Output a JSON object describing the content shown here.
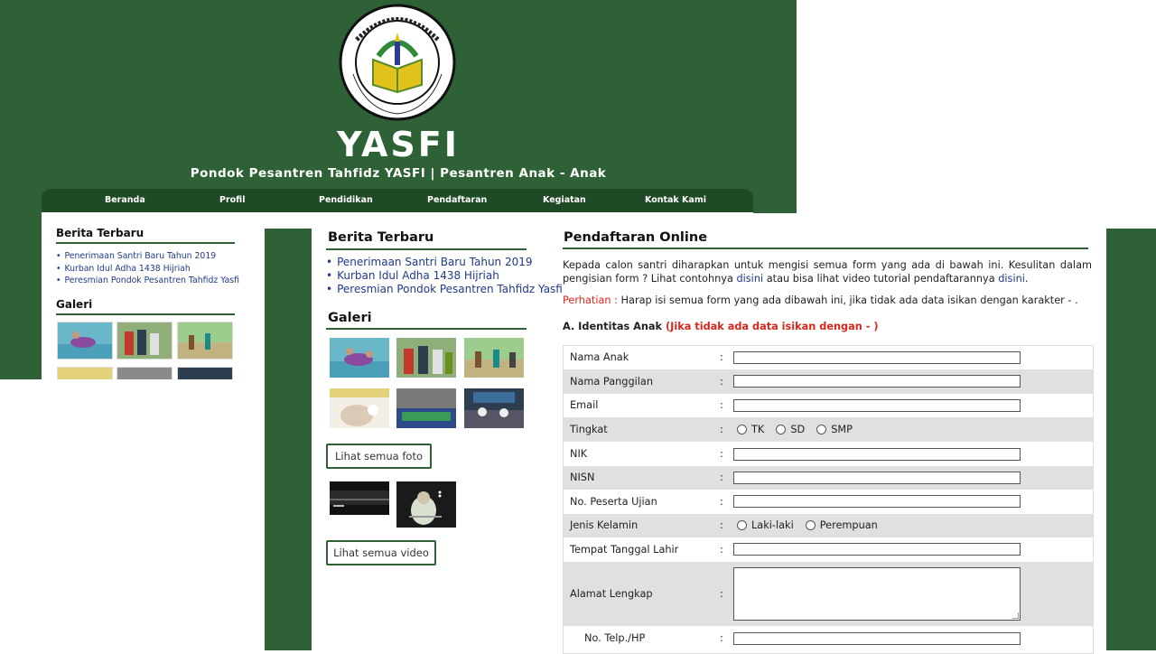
{
  "site": {
    "logo_text": "PONDOK PESANTREN TAHFIDZ YASFI",
    "title": "YASFI",
    "subtitle": "Pondok Pesantren Tahfidz YASFI | Pesantren Anak - Anak"
  },
  "nav": [
    "Beranda",
    "Profil",
    "Pendidikan",
    "Pendaftaran",
    "Kegiatan",
    "Kontak Kami"
  ],
  "sidebar": {
    "news_heading": "Berita Terbaru",
    "news": [
      "Penerimaan Santri Baru Tahun 2019",
      "Kurban Idul Adha 1438 Hijriah",
      "Peresmian Pondok Pesantren Tahfidz Yasfi"
    ],
    "gallery_heading": "Galeri",
    "see_photos": "Lihat semua foto",
    "see_videos": "Lihat semua video"
  },
  "form": {
    "heading": "Pendaftaran Online",
    "intro_before_link1": "Kepada calon santri diharapkan untuk mengisi semua form yang ada di bawah ini. Kesulitan dalam pengisian form ? Lihat contohnya ",
    "link1": "disini",
    "intro_middle": " atau bisa lihat video tutorial pendaftarannya ",
    "link2": "disini",
    "intro_end": ".",
    "warning_label": "Perhatian :",
    "warning_text": " Harap isi semua form yang ada dibawah ini, jika tidak ada data isikan dengan karakter - .",
    "section_title": "A. Identitas Anak",
    "section_note": "(Jika tidak ada data isikan dengan - )",
    "colon": ":",
    "fields": {
      "nama_anak": "Nama Anak",
      "nama_panggilan": "Nama Panggilan",
      "email": "Email",
      "tingkat": "Tingkat",
      "nik": "NIK",
      "nisn": "NISN",
      "no_peserta": "No. Peserta Ujian",
      "jenis_kelamin": "Jenis Kelamin",
      "ttl": "Tempat Tanggal Lahir",
      "alamat": "Alamat Lengkap",
      "telp": "No. Telp./HP"
    },
    "tingkat_options": [
      "TK",
      "SD",
      "SMP"
    ],
    "gender_options": [
      "Laki-laki",
      "Perempuan"
    ]
  },
  "colors": {
    "brand_green": "#2e6236",
    "nav_green": "#1f4a26",
    "link_blue": "#1f3a8a",
    "alert_red": "#d9261c"
  }
}
